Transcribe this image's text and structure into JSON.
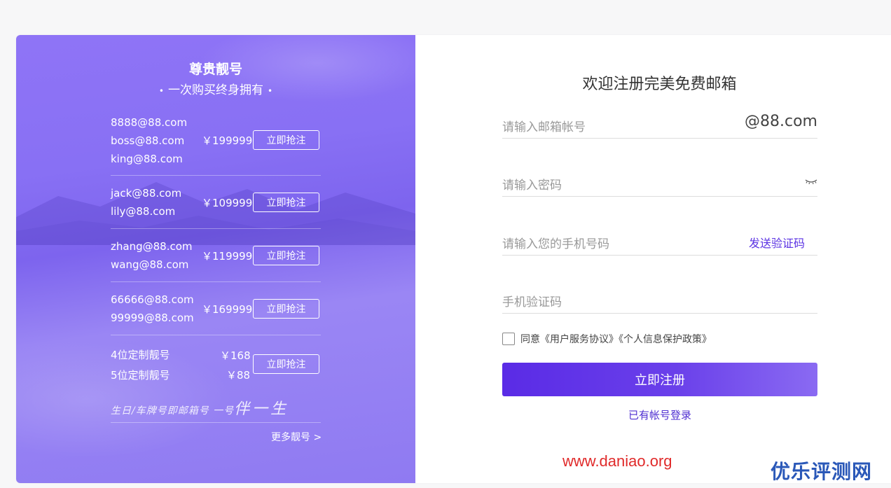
{
  "promo": {
    "title": "尊贵靓号",
    "subtitle_dot": "•",
    "subtitle": "一次购买终身拥有",
    "groups": [
      {
        "names": [
          "8888@88.com",
          "boss@88.com",
          "king@88.com"
        ],
        "price": "￥199999",
        "button": "立即抢注"
      },
      {
        "names": [
          "jack@88.com",
          "lily@88.com"
        ],
        "price": "￥109999",
        "button": "立即抢注"
      },
      {
        "names": [
          "zhang@88.com",
          "wang@88.com"
        ],
        "price": "￥119999",
        "button": "立即抢注"
      },
      {
        "names": [
          "66666@88.com",
          "99999@88.com"
        ],
        "price": "￥169999",
        "button": "立即抢注"
      },
      {
        "names": [
          "4位定制靓号",
          "5位定制靓号"
        ],
        "prices": [
          "￥168",
          "￥88"
        ],
        "button": "立即抢注"
      }
    ],
    "slogan_small": "生日/车牌号即邮箱号  一号",
    "slogan_big": "伴一生",
    "more": "更多靓号 >"
  },
  "form": {
    "title": "欢迎注册完美免费邮箱",
    "email_placeholder": "请输入邮箱帐号",
    "email_suffix": "@88.com",
    "password_placeholder": "请输入密码",
    "phone_placeholder": "请输入您的手机号码",
    "send_code": "发送验证码",
    "code_placeholder": "手机验证码",
    "agree_text": "同意《用户服务协议》《个人信息保护政策》",
    "agree_checked": false,
    "submit": "立即注册",
    "login_link": "已有帐号登录"
  },
  "watermarks": {
    "url": "www.daniao.org",
    "brand": "优乐评测网"
  },
  "colors": {
    "accent": "#5b33e3",
    "promo_bg": "#8870f4",
    "watermark_red": "#e02a2a",
    "watermark_blue": "#2a58b8"
  }
}
